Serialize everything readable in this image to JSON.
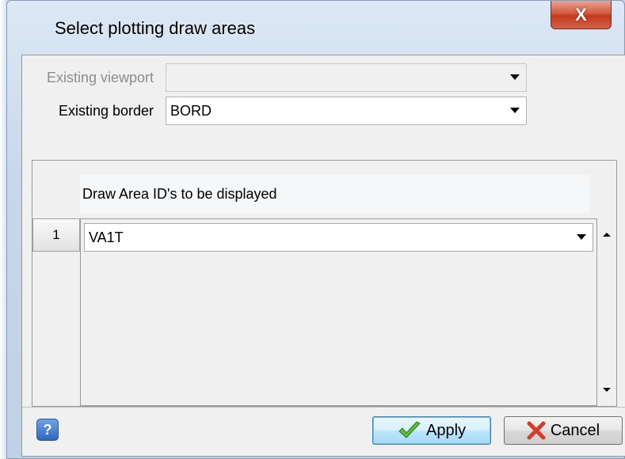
{
  "window": {
    "title": "Select plotting draw areas",
    "close_glyph": "X"
  },
  "form": {
    "viewport_label": "Existing viewport",
    "viewport_value": "",
    "border_label": "Existing border",
    "border_value": "BORD"
  },
  "grid": {
    "header": "Draw Area ID's to be displayed",
    "rows": [
      {
        "num": "1",
        "value": "VA1T"
      }
    ]
  },
  "footer": {
    "help_glyph": "?",
    "apply_label": "Apply",
    "cancel_label": "Cancel"
  },
  "colors": {
    "close_red": "#c23a1f",
    "apply_check": "#5bbd3a",
    "cancel_x": "#d93a2a"
  }
}
